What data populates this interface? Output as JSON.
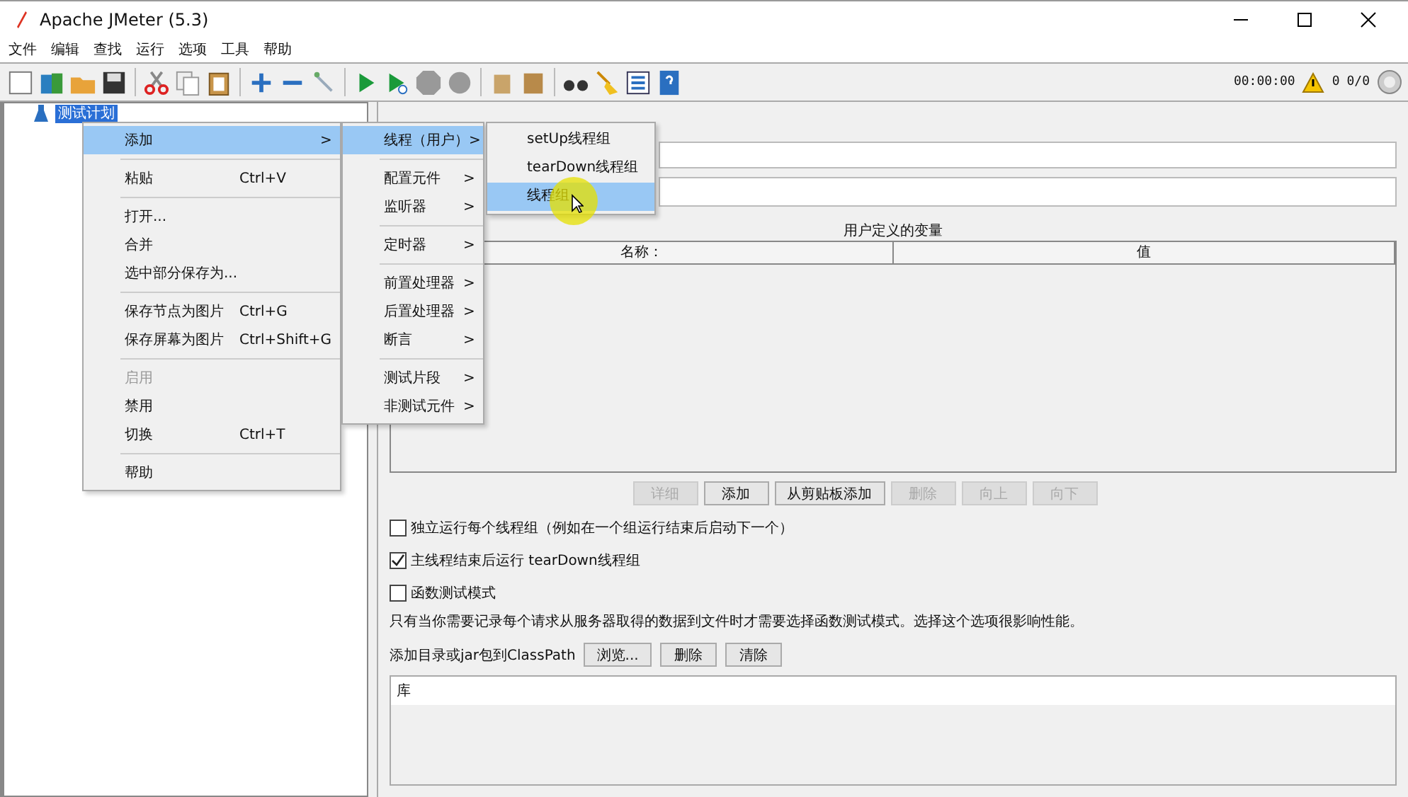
{
  "window": {
    "title": "Apache JMeter (5.3)"
  },
  "menu_bar": [
    "文件",
    "编辑",
    "查找",
    "运行",
    "选项",
    "工具",
    "帮助"
  ],
  "toolbar_status": {
    "timer": "00:00:00",
    "warnings": "0",
    "threads": "0/0"
  },
  "tree": [
    {
      "label": "测试计划",
      "selected": true
    }
  ],
  "context_menu": [
    [
      {
        "label": "添加",
        "arrow": ">",
        "selected": true,
        "disabled": false
      }
    ],
    [
      {
        "label": "粘贴",
        "shortcut": "Ctrl+V",
        "selected": false,
        "disabled": false
      }
    ],
    [
      {
        "label": "打开...",
        "selected": false,
        "disabled": false
      },
      {
        "label": "合并",
        "selected": false,
        "disabled": false
      },
      {
        "label": "选中部分保存为...",
        "selected": false,
        "disabled": false
      }
    ],
    [
      {
        "label": "保存节点为图片",
        "shortcut": "Ctrl+G",
        "selected": false,
        "disabled": false
      },
      {
        "label": "保存屏幕为图片",
        "shortcut": "Ctrl+Shift+G",
        "selected": false,
        "disabled": false
      }
    ],
    [
      {
        "label": "启用",
        "selected": false,
        "disabled": true
      },
      {
        "label": "禁用",
        "selected": false,
        "disabled": false
      },
      {
        "label": "切换",
        "shortcut": "Ctrl+T",
        "selected": false,
        "disabled": false
      }
    ],
    [
      {
        "label": "帮助",
        "selected": false,
        "disabled": false
      }
    ]
  ],
  "add_submenu": [
    [
      {
        "label": "线程（用户）",
        "arrow": ">",
        "selected": true
      }
    ],
    [
      {
        "label": "配置元件",
        "arrow": ">",
        "selected": false
      },
      {
        "label": "监听器",
        "arrow": ">",
        "selected": false
      }
    ],
    [
      {
        "label": "定时器",
        "arrow": ">",
        "selected": false
      }
    ],
    [
      {
        "label": "前置处理器",
        "arrow": ">",
        "selected": false
      },
      {
        "label": "后置处理器",
        "arrow": ">",
        "selected": false
      },
      {
        "label": "断言",
        "arrow": ">",
        "selected": false
      }
    ],
    [
      {
        "label": "测试片段",
        "arrow": ">",
        "selected": false
      },
      {
        "label": "非测试元件",
        "arrow": ">",
        "selected": false
      }
    ]
  ],
  "thread_submenu": [
    {
      "label": "setUp线程组",
      "selected": false
    },
    {
      "label": "tearDown线程组",
      "selected": false
    },
    {
      "label": "线程组",
      "selected": true
    }
  ],
  "variables": {
    "title": "用户定义的变量",
    "columns": [
      "名称：",
      "值"
    ]
  },
  "table_buttons": [
    {
      "label": "详细",
      "disabled": true
    },
    {
      "label": "添加",
      "disabled": false
    },
    {
      "label": "从剪贴板添加",
      "disabled": false
    },
    {
      "label": "删除",
      "disabled": true
    },
    {
      "label": "向上",
      "disabled": true
    },
    {
      "label": "向下",
      "disabled": true
    }
  ],
  "options": [
    {
      "label": "独立运行每个线程组（例如在一个组运行结束后启动下一个）",
      "checked": false
    },
    {
      "label": "主线程结束后运行 tearDown线程组",
      "checked": true
    },
    {
      "label": "函数测试模式",
      "checked": false
    }
  ],
  "note": "只有当你需要记录每个请求从服务器取得的数据到文件时才需要选择函数测试模式。选择这个选项很影响性能。",
  "classpath": {
    "label": "添加目录或jar包到ClassPath",
    "buttons": [
      "浏览...",
      "删除",
      "清除"
    ]
  },
  "library": {
    "columns": [
      "库"
    ]
  }
}
